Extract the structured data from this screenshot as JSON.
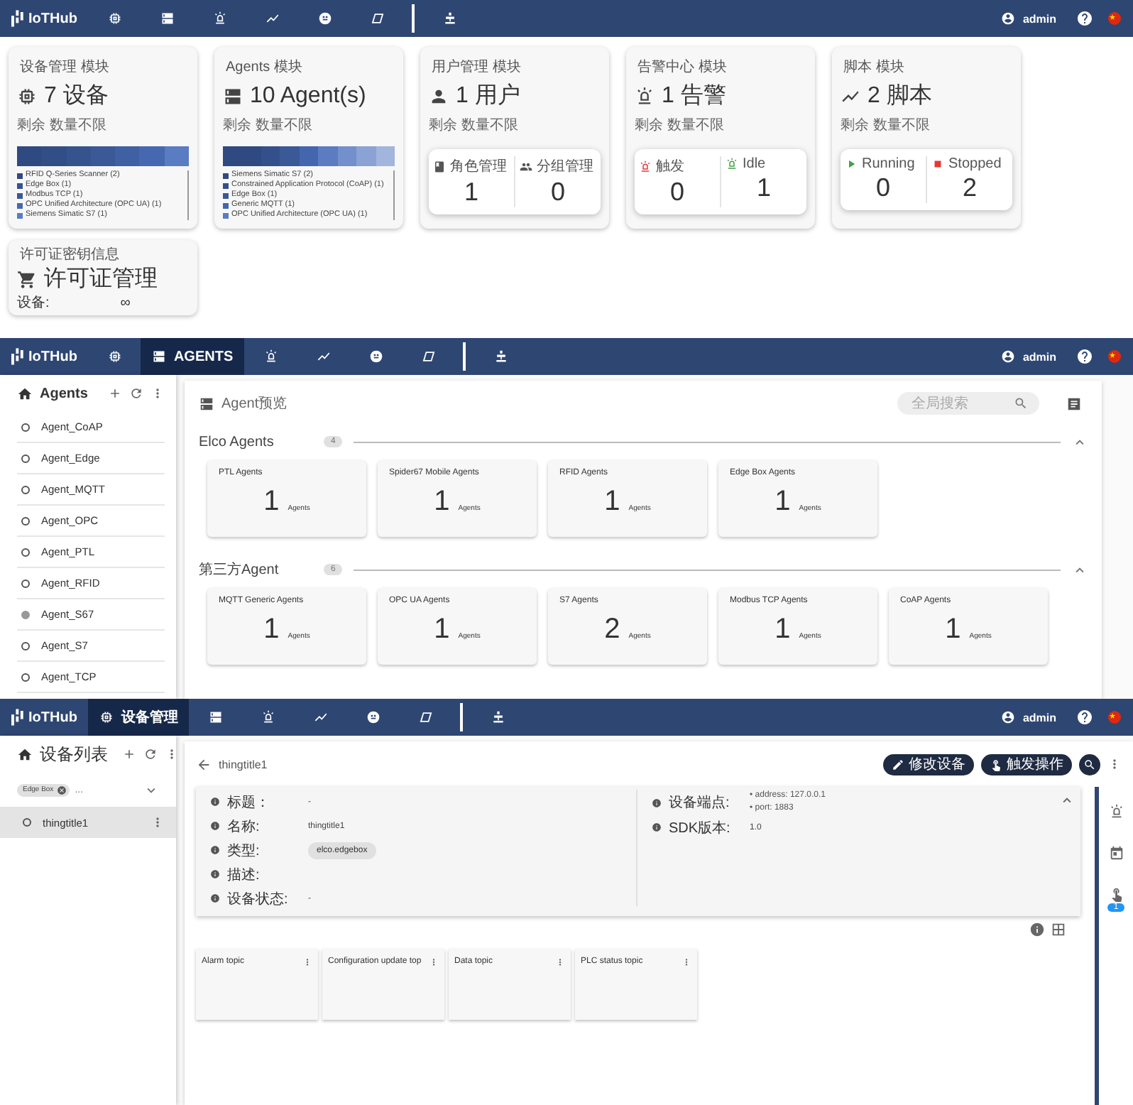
{
  "overview": {
    "navbar": {
      "brand": "IoTHub",
      "items": [
        {
          "kind": "devices",
          "selected": false
        },
        {
          "kind": "agents",
          "selected": false
        },
        {
          "kind": "alarms",
          "selected": false
        },
        {
          "kind": "scripts",
          "selected": false
        },
        {
          "kind": "dashboards",
          "selected": false
        },
        {
          "kind": "rules",
          "selected": false
        }
      ],
      "tools": [
        {
          "kind": "plugins",
          "selected": false
        }
      ],
      "user": "admin"
    },
    "cards": [
      {
        "kind": "devices",
        "title": "设备管理 模块",
        "headline": "7 设备",
        "note": "剩余 数量不限",
        "segments": [
          {
            "color": "#2f4a80"
          },
          {
            "color": "#324e86"
          },
          {
            "color": "#36538e"
          },
          {
            "color": "#3a5996"
          },
          {
            "color": "#3f60a2"
          },
          {
            "color": "#4668b0"
          },
          {
            "color": "#5a7cc2"
          }
        ],
        "legend": [
          {
            "label": "RFID Q-Series Scanner (2)",
            "color": "#2f4a80"
          },
          {
            "label": "Edge Box (1)",
            "color": "#36538e"
          },
          {
            "label": "Modbus TCP (1)",
            "color": "#3a5996"
          },
          {
            "label": "OPC Unified Architecture (OPC UA) (1)",
            "color": "#4668b0"
          },
          {
            "label": "Siemens Simatic S7 (1)",
            "color": "#5a7cc2"
          }
        ]
      },
      {
        "kind": "agents",
        "title": "Agents 模块",
        "headline": "10 Agent(s)",
        "note": "剩余 数量不限",
        "segments": [
          {
            "color": "#2f4a80"
          },
          {
            "color": "#2f4a80"
          },
          {
            "color": "#34508a"
          },
          {
            "color": "#3a5996"
          },
          {
            "color": "#4466ae"
          },
          {
            "color": "#5b7cc0"
          },
          {
            "color": "#7390cc"
          },
          {
            "color": "#8aa2d4"
          },
          {
            "color": "#a2b5dd"
          }
        ],
        "legend": [
          {
            "label": "Siemens Simatic S7 (2)",
            "color": "#2f4a80"
          },
          {
            "label": "Constrained Application Protocol (CoAP) (1)",
            "color": "#34508a"
          },
          {
            "label": "Edge Box (1)",
            "color": "#3a5996"
          },
          {
            "label": "Generic MQTT (1)",
            "color": "#4466ae"
          },
          {
            "label": "OPC Unified Architecture (OPC UA) (1)",
            "color": "#5b7cc0"
          }
        ]
      },
      {
        "kind": "users",
        "title": "用户管理 模块",
        "headline": "1 用户",
        "note": "剩余 数量不限",
        "stats": [
          {
            "kind": "roles",
            "label": "角色管理",
            "value": "1"
          },
          {
            "kind": "groups",
            "label": "分组管理",
            "value": "0"
          }
        ]
      },
      {
        "kind": "alarms",
        "title": "告警中心 模块",
        "headline": "1 告警",
        "note": "剩余 数量不限",
        "stats": [
          {
            "kind": "triggered",
            "label": "触发",
            "value": "0"
          },
          {
            "kind": "idle",
            "label": "Idle",
            "value": "1"
          }
        ]
      },
      {
        "kind": "scripts",
        "title": "脚本 模块",
        "headline": "2 脚本",
        "note": "剩余 数量不限",
        "stats": [
          {
            "kind": "running",
            "label": "Running",
            "value": "0"
          },
          {
            "kind": "stopped",
            "label": "Stopped",
            "value": "2"
          }
        ]
      }
    ],
    "license": {
      "title": "许可证密钥信息",
      "headline": "许可证管理",
      "rows": [
        {
          "label": "设备:",
          "value": "∞"
        }
      ]
    }
  },
  "agents_page": {
    "navbar": {
      "brand": "IoTHub",
      "items": [
        {
          "kind": "devices",
          "selected": false
        },
        {
          "kind": "agents",
          "label": "AGENTS",
          "selected": true
        },
        {
          "kind": "alarms",
          "selected": false
        },
        {
          "kind": "scripts",
          "selected": false
        },
        {
          "kind": "dashboards",
          "selected": false
        },
        {
          "kind": "rules",
          "selected": false
        }
      ],
      "tools": [
        {
          "kind": "plugins",
          "selected": false
        }
      ],
      "user": "admin"
    },
    "sidebar": {
      "title": "Agents",
      "items": [
        {
          "label": "Agent_CoAP",
          "active": false
        },
        {
          "label": "Agent_Edge",
          "active": false
        },
        {
          "label": "Agent_MQTT",
          "active": false
        },
        {
          "label": "Agent_OPC",
          "active": false
        },
        {
          "label": "Agent_PTL",
          "active": false
        },
        {
          "label": "Agent_RFID",
          "active": false
        },
        {
          "label": "Agent_S67",
          "active": true
        },
        {
          "label": "Agent_S7",
          "active": false
        },
        {
          "label": "Agent_TCP",
          "active": false
        }
      ]
    },
    "main": {
      "title": "Agent预览",
      "search": {
        "placeholder": "全局搜索"
      },
      "groups": [
        {
          "title": "Elco Agents",
          "count": "4",
          "expanded": true,
          "cards": [
            {
              "title": "PTL Agents",
              "value": "1",
              "unit": "Agents"
            },
            {
              "title": "Spider67 Mobile Agents",
              "value": "1",
              "unit": "Agents"
            },
            {
              "title": "RFID Agents",
              "value": "1",
              "unit": "Agents"
            },
            {
              "title": "Edge Box Agents",
              "value": "1",
              "unit": "Agents"
            }
          ]
        },
        {
          "title": "第三方Agent",
          "count": "6",
          "expanded": true,
          "cards": [
            {
              "title": "MQTT Generic Agents",
              "value": "1",
              "unit": "Agents"
            },
            {
              "title": "OPC UA Agents",
              "value": "1",
              "unit": "Agents"
            },
            {
              "title": "S7 Agents",
              "value": "2",
              "unit": "Agents"
            },
            {
              "title": "Modbus TCP Agents",
              "value": "1",
              "unit": "Agents"
            },
            {
              "title": "CoAP Agents",
              "value": "1",
              "unit": "Agents"
            }
          ]
        }
      ]
    }
  },
  "device_page": {
    "navbar": {
      "brand": "IoTHub",
      "items": [
        {
          "kind": "devices",
          "label": "设备管理",
          "selected": true
        },
        {
          "kind": "agents",
          "selected": false
        },
        {
          "kind": "alarms",
          "selected": false
        },
        {
          "kind": "scripts",
          "selected": false
        },
        {
          "kind": "dashboards",
          "selected": false
        },
        {
          "kind": "rules",
          "selected": false
        }
      ],
      "tools": [
        {
          "kind": "plugins",
          "selected": false
        }
      ],
      "user": "admin"
    },
    "sidebar": {
      "title": "设备列表",
      "filter": {
        "chip": "Edge Box",
        "more": "..."
      },
      "items": [
        {
          "label": "thingtitle1",
          "selected": true,
          "active": false
        }
      ]
    },
    "main": {
      "title": "thingtitle1",
      "actions": [
        {
          "kind": "edit",
          "label": "修改设备"
        },
        {
          "kind": "trigger",
          "label": "触发操作"
        }
      ],
      "info": {
        "expanded": true,
        "left": [
          {
            "label": "标题：",
            "value": "-"
          },
          {
            "label": "名称:",
            "value": "thingtitle1"
          },
          {
            "label": "类型:",
            "chip": "elco.edgebox"
          },
          {
            "label": "描述:"
          },
          {
            "label": "设备状态:",
            "value": "-"
          }
        ],
        "right": [
          {
            "label": "设备端点:",
            "list": [
              "• address: 127.0.0.1",
              "• port: 1883"
            ]
          },
          {
            "label": "SDK版本:",
            "value": "1.0"
          }
        ]
      },
      "topics": [
        {
          "title": "Alarm topic"
        },
        {
          "title": "Configuration update top"
        },
        {
          "title": "Data topic"
        },
        {
          "title": "PLC status topic"
        }
      ]
    },
    "rail": [
      {
        "kind": "alarms"
      },
      {
        "kind": "calendar"
      },
      {
        "kind": "trigger",
        "badge": "1"
      }
    ]
  }
}
